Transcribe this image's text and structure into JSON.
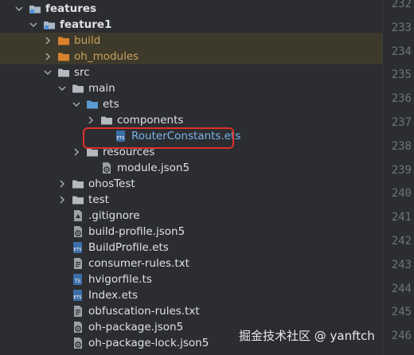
{
  "tree": {
    "items": [
      {
        "label": "features",
        "depth": 0,
        "expanded": true,
        "icon": "module-folder-icon",
        "style": "bold"
      },
      {
        "label": "feature1",
        "depth": 1,
        "expanded": true,
        "icon": "module-folder-icon",
        "style": "bold"
      },
      {
        "label": "build",
        "depth": 2,
        "expanded": false,
        "icon": "orange-folder-icon",
        "style": "excluded",
        "highlight": true
      },
      {
        "label": "oh_modules",
        "depth": 2,
        "expanded": false,
        "icon": "orange-folder-icon",
        "style": "excluded",
        "highlight": true
      },
      {
        "label": "src",
        "depth": 2,
        "expanded": true,
        "icon": "folder-icon",
        "style": "normal"
      },
      {
        "label": "main",
        "depth": 3,
        "expanded": true,
        "icon": "folder-icon",
        "style": "normal"
      },
      {
        "label": "ets",
        "depth": 4,
        "expanded": true,
        "icon": "blue-folder-icon",
        "style": "normal"
      },
      {
        "label": "components",
        "depth": 5,
        "expanded": false,
        "icon": "folder-icon",
        "style": "normal"
      },
      {
        "label": "RouterConstants.ets",
        "depth": 6,
        "expanded": null,
        "icon": "ets-file-icon",
        "style": "linkish"
      },
      {
        "label": "resources",
        "depth": 4,
        "expanded": false,
        "icon": "folder-icon",
        "style": "normal"
      },
      {
        "label": "module.json5",
        "depth": 5,
        "expanded": null,
        "icon": "json-file-icon",
        "style": "normal"
      },
      {
        "label": "ohosTest",
        "depth": 3,
        "expanded": false,
        "icon": "folder-icon",
        "style": "normal"
      },
      {
        "label": "test",
        "depth": 3,
        "expanded": false,
        "icon": "folder-icon",
        "style": "normal"
      },
      {
        "label": ".gitignore",
        "depth": 3,
        "expanded": null,
        "icon": "gitignore-file-icon",
        "style": "normal"
      },
      {
        "label": "build-profile.json5",
        "depth": 3,
        "expanded": null,
        "icon": "json-file-icon",
        "style": "normal"
      },
      {
        "label": "BuildProfile.ets",
        "depth": 3,
        "expanded": null,
        "icon": "ets-file-icon",
        "style": "normal"
      },
      {
        "label": "consumer-rules.txt",
        "depth": 3,
        "expanded": null,
        "icon": "text-file-icon",
        "style": "normal"
      },
      {
        "label": "hvigorfile.ts",
        "depth": 3,
        "expanded": null,
        "icon": "ts-file-icon",
        "style": "normal"
      },
      {
        "label": "Index.ets",
        "depth": 3,
        "expanded": null,
        "icon": "ets-file-icon",
        "style": "normal"
      },
      {
        "label": "obfuscation-rules.txt",
        "depth": 3,
        "expanded": null,
        "icon": "text-file-icon",
        "style": "normal"
      },
      {
        "label": "oh-package.json5",
        "depth": 3,
        "expanded": null,
        "icon": "json-file-icon",
        "style": "normal"
      },
      {
        "label": "oh-package-lock.json5",
        "depth": 3,
        "expanded": null,
        "icon": "json-file-icon",
        "style": "normal"
      }
    ]
  },
  "gutter": {
    "line_numbers": [
      "232",
      "233",
      "234",
      "235",
      "236",
      "237",
      "238",
      "239",
      "240",
      "241",
      "242",
      "243",
      "244",
      "245",
      "246"
    ]
  },
  "watermark": "掘金技术社区 @ yanftch",
  "colors": {
    "background": "#2b2d30",
    "text": "#dfe1e5",
    "excluded_text": "#c9a25a",
    "linkish_text": "#7cb4ef",
    "highlight_row": "#3d3a2c",
    "annotation_box": "#e0302b",
    "line_number": "#6f737a"
  }
}
